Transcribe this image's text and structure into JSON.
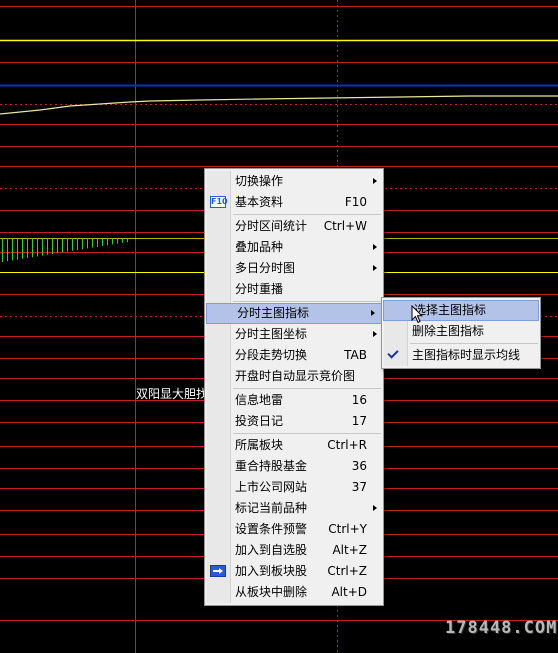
{
  "overlay_text": "双阳显大胆找",
  "watermark": "178448.COM",
  "context_menu": {
    "items": [
      {
        "label": "切换操作",
        "submenu": true
      },
      {
        "label": "基本资料",
        "shortcut": "F10",
        "icon": "f10-icon"
      },
      {
        "separator": true
      },
      {
        "label": "分时区间统计",
        "shortcut": "Ctrl+W"
      },
      {
        "label": "叠加品种",
        "submenu": true
      },
      {
        "label": "多日分时图",
        "submenu": true
      },
      {
        "label": "分时重播"
      },
      {
        "separator": true
      },
      {
        "label": "分时主图指标",
        "submenu": true,
        "highlighted": true
      },
      {
        "label": "分时主图坐标",
        "submenu": true
      },
      {
        "label": "分段走势切换",
        "shortcut": "TAB"
      },
      {
        "label": "开盘时自动显示竞价图"
      },
      {
        "separator": true
      },
      {
        "label": "信息地雷",
        "shortcut": "16"
      },
      {
        "label": "投资日记",
        "shortcut": "17"
      },
      {
        "separator": true
      },
      {
        "label": "所属板块",
        "shortcut": "Ctrl+R"
      },
      {
        "label": "重合持股基金",
        "shortcut": "36"
      },
      {
        "label": "上市公司网站",
        "shortcut": "37"
      },
      {
        "label": "标记当前品种",
        "submenu": true
      },
      {
        "label": "设置条件预警",
        "shortcut": "Ctrl+Y"
      },
      {
        "label": "加入到自选股",
        "shortcut": "Alt+Z"
      },
      {
        "label": "加入到板块股",
        "shortcut": "Ctrl+Z",
        "icon": "add-to-block-icon"
      },
      {
        "label": "从板块中删除",
        "shortcut": "Alt+D"
      }
    ]
  },
  "submenu": {
    "items": [
      {
        "label": "选择主图指标",
        "highlighted": true
      },
      {
        "label": "删除主图指标"
      },
      {
        "separator": true
      },
      {
        "label": "主图指标时显示均线",
        "checked": true
      }
    ]
  },
  "colors": {
    "background": "#000000",
    "grid_red": "#c0202a",
    "line_yellow": "#ffff00",
    "line_blue": "#1030c0",
    "volume_green": "#30d030",
    "menu_bg": "#f0f0f0",
    "menu_highlight": "#b3c3e8"
  }
}
